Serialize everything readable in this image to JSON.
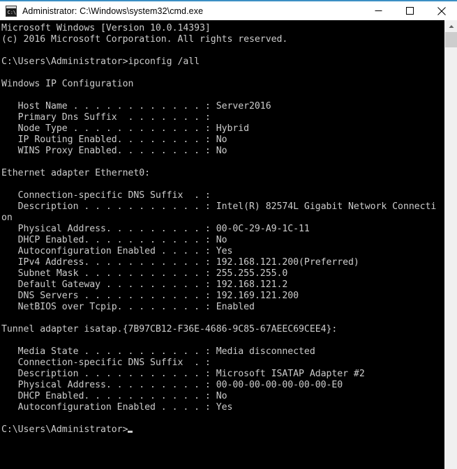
{
  "window": {
    "title": "Administrator: C:\\Windows\\system32\\cmd.exe",
    "icon": "cmd-console-icon",
    "accent_color": "#3b8fc4",
    "titlebar_bg": "#ffffff",
    "console_bg": "#000000",
    "console_fg": "#cccccc"
  },
  "caption": {
    "minimize_label": "Minimize",
    "maximize_label": "Maximize",
    "close_label": "Close"
  },
  "scrollbar": {
    "up_arrow_label": "Scroll up",
    "thumb_label": "Scroll thumb",
    "track_color": "#f0f0f0",
    "thumb_color": "#cdcdcd"
  },
  "console": {
    "prompt": "C:\\Users\\Administrator>",
    "command": "ipconfig /all",
    "cursor": "block-underscore-cursor",
    "lines": [
      "Microsoft Windows [Version 10.0.14393]",
      "(c) 2016 Microsoft Corporation. All rights reserved.",
      "",
      "C:\\Users\\Administrator>ipconfig /all",
      "",
      "Windows IP Configuration",
      "",
      "   Host Name . . . . . . . . . . . . : Server2016",
      "   Primary Dns Suffix  . . . . . . . :",
      "   Node Type . . . . . . . . . . . . : Hybrid",
      "   IP Routing Enabled. . . . . . . . : No",
      "   WINS Proxy Enabled. . . . . . . . : No",
      "",
      "Ethernet adapter Ethernet0:",
      "",
      "   Connection-specific DNS Suffix  . :",
      "   Description . . . . . . . . . . . : Intel(R) 82574L Gigabit Network Connecti",
      "on",
      "   Physical Address. . . . . . . . . : 00-0C-29-A9-1C-11",
      "   DHCP Enabled. . . . . . . . . . . : No",
      "   Autoconfiguration Enabled . . . . : Yes",
      "   IPv4 Address. . . . . . . . . . . : 192.168.121.200(Preferred)",
      "   Subnet Mask . . . . . . . . . . . : 255.255.255.0",
      "   Default Gateway . . . . . . . . . : 192.168.121.2",
      "   DNS Servers . . . . . . . . . . . : 192.169.121.200",
      "   NetBIOS over Tcpip. . . . . . . . : Enabled",
      "",
      "Tunnel adapter isatap.{7B97CB12-F36E-4686-9C85-67AEEC69CEE4}:",
      "",
      "   Media State . . . . . . . . . . . : Media disconnected",
      "   Connection-specific DNS Suffix  . :",
      "   Description . . . . . . . . . . . : Microsoft ISATAP Adapter #2",
      "   Physical Address. . . . . . . . . : 00-00-00-00-00-00-00-E0",
      "   DHCP Enabled. . . . . . . . . . . : No",
      "   Autoconfiguration Enabled . . . . : Yes",
      "",
      "C:\\Users\\Administrator>"
    ]
  }
}
